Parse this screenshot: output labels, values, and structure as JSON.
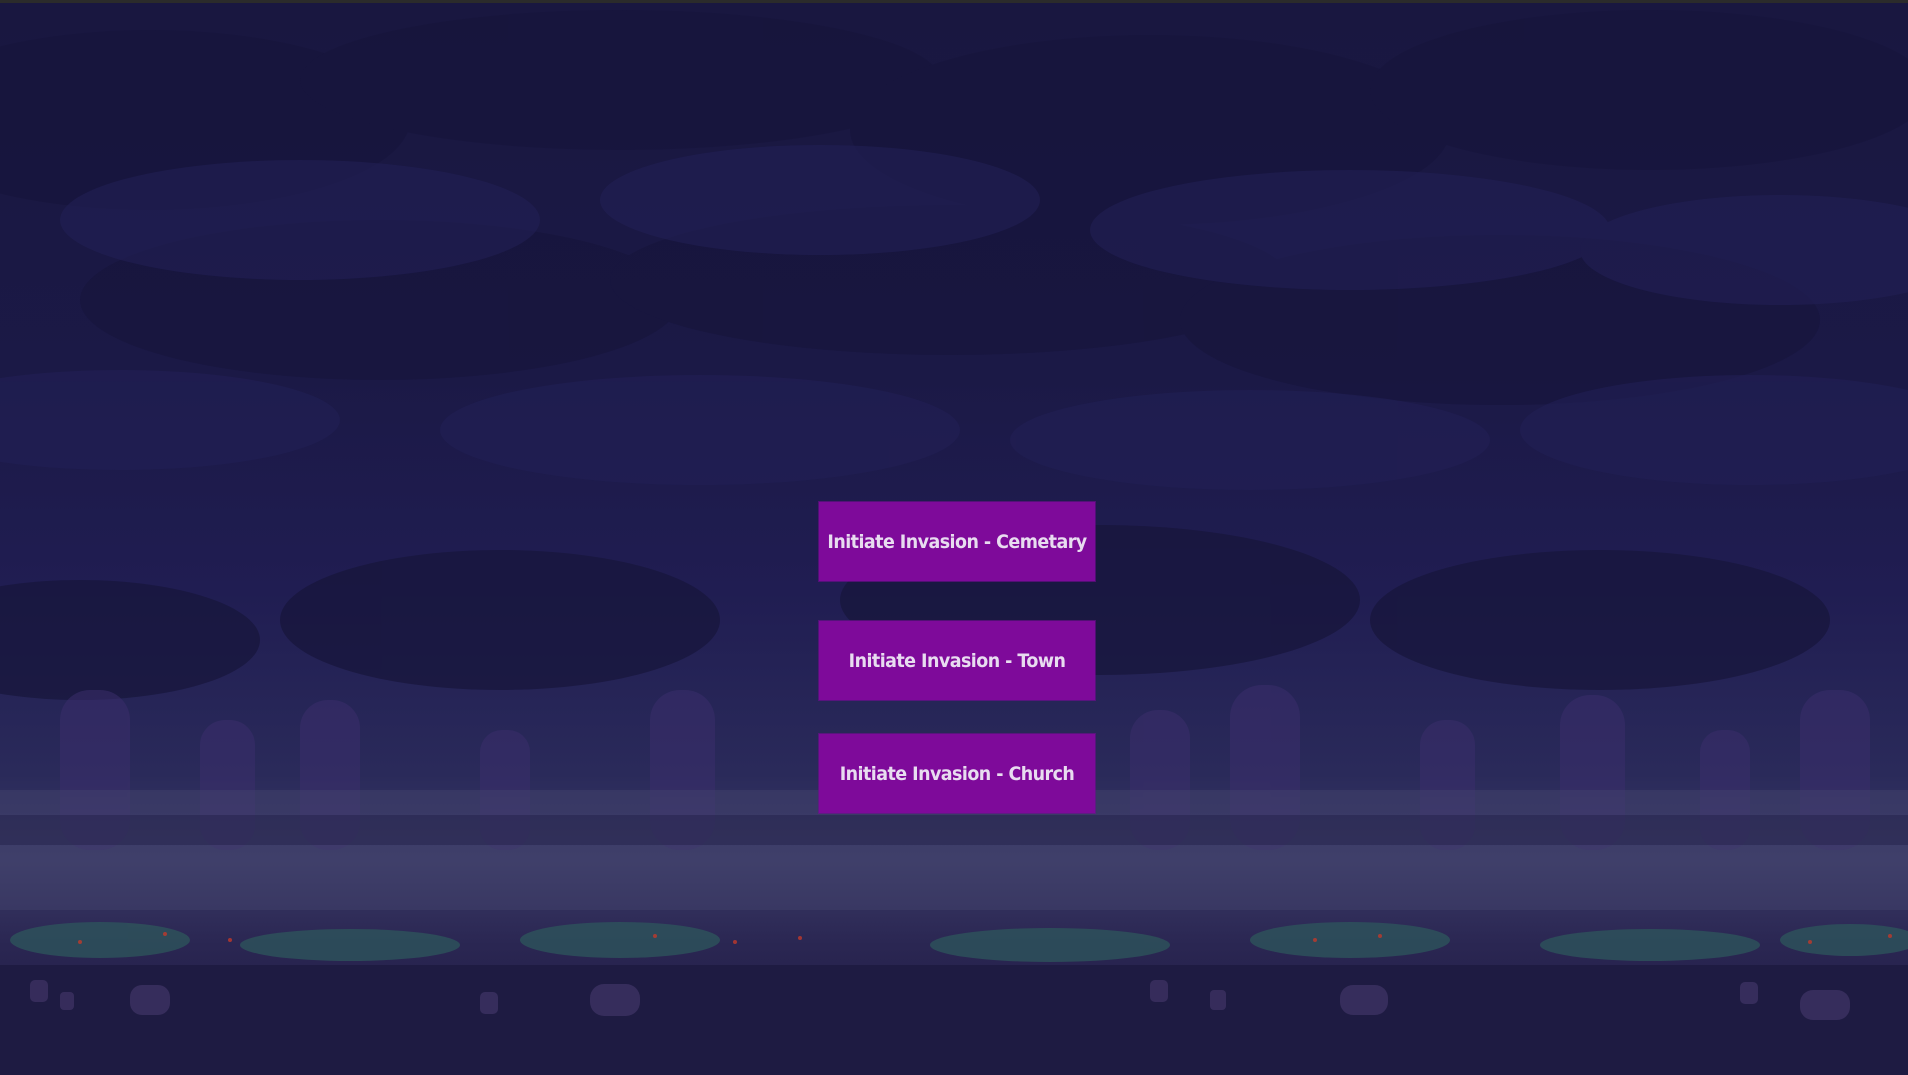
{
  "colors": {
    "sky": "#1b1946",
    "button_bg": "#7e0a9a",
    "button_text": "#e8dcf0"
  },
  "menu": {
    "buttons": [
      {
        "label": "Initiate Invasion - Cemetary"
      },
      {
        "label": "Initiate Invasion - Town"
      },
      {
        "label": "Initiate Invasion - Church"
      }
    ]
  }
}
